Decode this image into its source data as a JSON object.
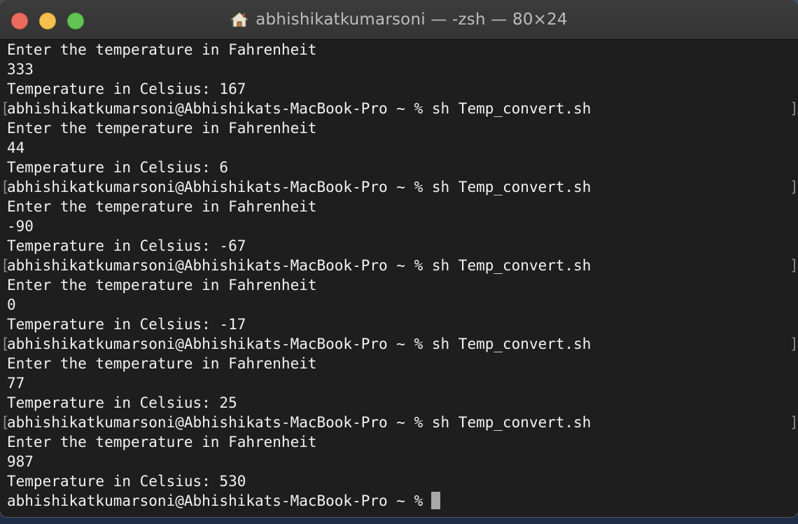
{
  "window": {
    "title": "abhishikatkumarsoni — -zsh — 80×24"
  },
  "terminal": {
    "lines": [
      "Enter the temperature in Fahrenheit",
      "333",
      "Temperature in Celsius: 167",
      "abhishikatkumarsoni@Abhishikats-MacBook-Pro ~ % sh Temp_convert.sh",
      "Enter the temperature in Fahrenheit",
      "44",
      "Temperature in Celsius: 6",
      "abhishikatkumarsoni@Abhishikats-MacBook-Pro ~ % sh Temp_convert.sh",
      "Enter the temperature in Fahrenheit",
      "-90",
      "Temperature in Celsius: -67",
      "abhishikatkumarsoni@Abhishikats-MacBook-Pro ~ % sh Temp_convert.sh",
      "Enter the temperature in Fahrenheit",
      "0",
      "Temperature in Celsius: -17",
      "abhishikatkumarsoni@Abhishikats-MacBook-Pro ~ % sh Temp_convert.sh",
      "Enter the temperature in Fahrenheit",
      "77",
      "Temperature in Celsius: 25",
      "abhishikatkumarsoni@Abhishikats-MacBook-Pro ~ % sh Temp_convert.sh",
      "Enter the temperature in Fahrenheit",
      "987",
      "Temperature in Celsius: 530"
    ],
    "prompt": "abhishikatkumarsoni@Abhishikats-MacBook-Pro ~ %"
  },
  "colors": {
    "background": "#1e1e1e",
    "text": "#f2f2f2",
    "close": "#ed6a5e",
    "minimize": "#f5bf4f",
    "zoom": "#61c454"
  },
  "icons": {
    "title": "home-icon",
    "cursor": "block-cursor"
  }
}
